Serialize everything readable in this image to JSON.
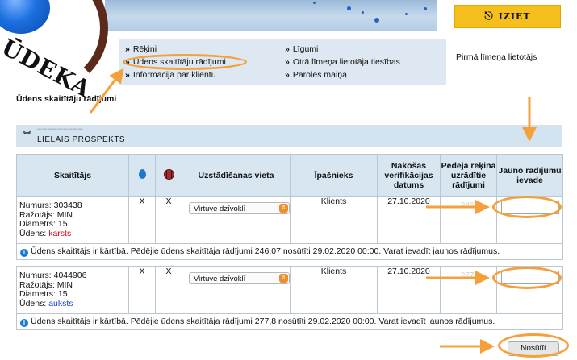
{
  "header": {
    "logo_text": "ŪDEKA",
    "logout_label": "IZIET",
    "user_level": "Pirmā līmeņa lietotājs"
  },
  "nav": {
    "left": [
      "Rēķini",
      "Ūdens skaitītāju rādījumi",
      "Informācija par klientu"
    ],
    "right": [
      "Līgumi",
      "Otrā līmeņa lietotāja tiesības",
      "Paroles maiņa"
    ]
  },
  "page_title": "Ūdens skaitītāju rādījumi",
  "address": {
    "label": "LIELAIS PROSPEKTS"
  },
  "table": {
    "headers": {
      "meter": "Skaitītājs",
      "location": "Uzstādīšanas vieta",
      "owner": "Īpašnieks",
      "next_verification": "Nākošās verifikācijas datums",
      "last_reading": "Pēdējā rēķinā uzrādītie rādījumi",
      "new_reading": "Jauno rādījumu ievade"
    },
    "labels": {
      "number": "Numurs:",
      "manufacturer": "Ražotājs:",
      "diameter": "Diametrs:",
      "water": "Ūdens:"
    },
    "rows": [
      {
        "number": "303438",
        "manufacturer": "MIN",
        "diameter": "15",
        "water_type": "karsts",
        "col1": "X",
        "col2": "X",
        "location": "Virtuve dzīvoklī",
        "owner": "Klients",
        "next_verification": "27.10.2020",
        "last_reading_partial": "246,",
        "status": "Ūdens skaitītājs ir kārtībā. Pēdējie ūdens skaitītāja rādījumi 246,07 nosūtīti 29.02.2020 00:00. Varat ievadīt jaunos rādījumus."
      },
      {
        "number": "4044906",
        "manufacturer": "MIN",
        "diameter": "15",
        "water_type": "auksts",
        "col1": "X",
        "col2": "X",
        "location": "Virtuve dzīvoklī",
        "owner": "Klients",
        "next_verification": "27.10.2020",
        "last_reading_partial": "277,",
        "status": "Ūdens skaitītājs ir kārtībā. Pēdējie ūdens skaitītāja rādījumi 277,8 nosūtīti 29.02.2020 00:00. Varat ievadīt jaunos rādījumus."
      }
    ]
  },
  "submit_label": "Nosūtīt",
  "colors": {
    "accent_yellow": "#f5c01e",
    "header_blue": "#d7e6f1",
    "annotation_orange": "#f5a03a",
    "hot_red": "#d0021b",
    "cold_blue": "#1a3fd6"
  }
}
